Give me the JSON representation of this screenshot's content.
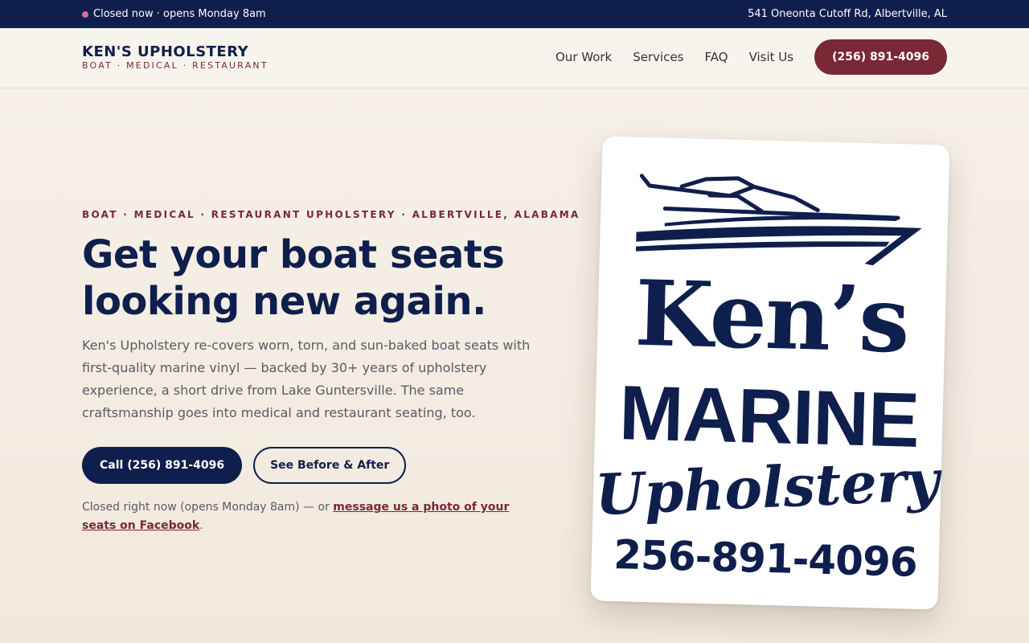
{
  "topbar": {
    "status": "Closed now · opens Monday 8am",
    "address": "541 Oneonta Cutoff Rd, Albertville, AL"
  },
  "brand": {
    "name": "KEN'S UPHOLSTERY",
    "tagline": "BOAT · MEDICAL · RESTAURANT"
  },
  "nav": {
    "items": [
      "Our Work",
      "Services",
      "FAQ",
      "Visit Us"
    ],
    "phone": "(256) 891-4096"
  },
  "hero": {
    "eyebrow": "BOAT · MEDICAL · RESTAURANT UPHOLSTERY · ALBERTVILLE, ALABAMA",
    "headline": "Get your boat seats looking new again.",
    "lead": "Ken's Upholstery re-covers worn, torn, and sun-baked boat seats with first-quality marine vinyl — backed by 30+ years of upholstery experience, a short drive from Lake Guntersville. The same craftsmanship goes into medical and restaurant seating, too.",
    "cta_primary": "Call (256) 891-4096",
    "cta_secondary": "See Before & After",
    "note_prefix": "Closed right now (opens Monday 8am) — or ",
    "note_link": "message us a photo of your seats on Facebook",
    "note_suffix": "."
  },
  "sign": {
    "line1": "Ken’s",
    "line2": "MARINE",
    "line3": "Upholstery",
    "phone": "256-891-4096",
    "icon": "boat-icon"
  },
  "colors": {
    "navy": "#0f1f4d",
    "maroon": "#7a2736",
    "status_dot": "#d9738a",
    "background": "#f6f1ea"
  }
}
